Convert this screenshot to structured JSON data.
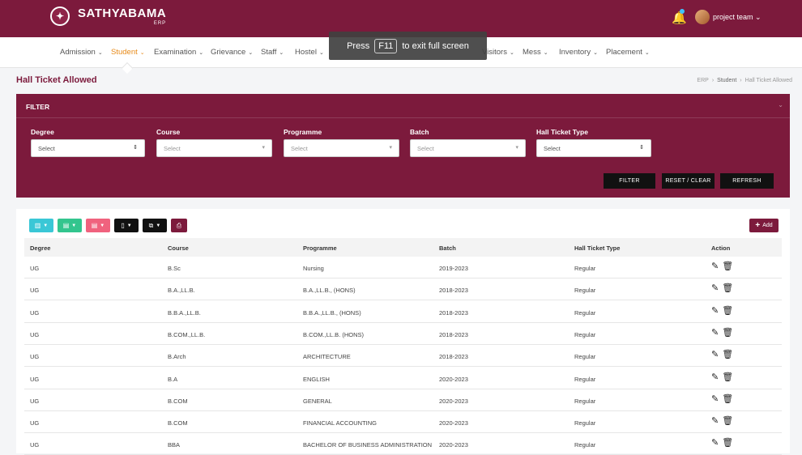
{
  "header": {
    "brand_name": "SATHYABAMA",
    "brand_sub": "ERP",
    "user_name": "project team",
    "user_caret": "⌄"
  },
  "nav": {
    "items": [
      {
        "label": "Admission"
      },
      {
        "label": "Student",
        "active": true
      },
      {
        "label": "Examination"
      },
      {
        "label": "Grievance"
      },
      {
        "label": "Staff"
      },
      {
        "label": "Hostel"
      },
      {
        "label": "Visitors"
      },
      {
        "label": "Mess"
      },
      {
        "label": "Inventory"
      },
      {
        "label": "Placement"
      }
    ],
    "accent_color": "#e78a19"
  },
  "toast": {
    "pre": "Press",
    "key": "F11",
    "post": "to exit full screen"
  },
  "page": {
    "title": "Hall Ticket Allowed",
    "breadcrumb": [
      "ERP",
      "Student",
      "Hall Ticket Allowed"
    ]
  },
  "filter": {
    "title": "FILTER",
    "fields": [
      {
        "label": "Degree",
        "value": "Select"
      },
      {
        "label": "Course",
        "value": "Select"
      },
      {
        "label": "Programme",
        "value": "Select"
      },
      {
        "label": "Batch",
        "value": "Select"
      },
      {
        "label": "Hall Ticket Type",
        "value": "Select"
      }
    ],
    "buttons": {
      "filter": "FILTER",
      "reset": "RESET / CLEAR",
      "refresh": "REFRESH"
    }
  },
  "table": {
    "add_label": "Add",
    "columns": [
      "Degree",
      "Course",
      "Programme",
      "Batch",
      "Hall Ticket Type",
      "Action"
    ],
    "rows": [
      {
        "degree": "UG",
        "course": "B.Sc",
        "programme": "Nursing",
        "batch": "2019-2023",
        "type": "Regular"
      },
      {
        "degree": "UG",
        "course": "B.A.,LL.B.",
        "programme": "B.A.,LL.B., (HONS)",
        "batch": "2018-2023",
        "type": "Regular"
      },
      {
        "degree": "UG",
        "course": "B.B.A.,LL.B.",
        "programme": "B.B.A.,LL.B., (HONS)",
        "batch": "2018-2023",
        "type": "Regular"
      },
      {
        "degree": "UG",
        "course": "B.COM.,LL.B.",
        "programme": "B.COM.,LL.B. (HONS)",
        "batch": "2018-2023",
        "type": "Regular"
      },
      {
        "degree": "UG",
        "course": "B.Arch",
        "programme": "ARCHITECTURE",
        "batch": "2018-2023",
        "type": "Regular"
      },
      {
        "degree": "UG",
        "course": "B.A",
        "programme": "ENGLISH",
        "batch": "2020-2023",
        "type": "Regular"
      },
      {
        "degree": "UG",
        "course": "B.COM",
        "programme": "GENERAL",
        "batch": "2020-2023",
        "type": "Regular"
      },
      {
        "degree": "UG",
        "course": "B.COM",
        "programme": "FINANCIAL ACCOUNTING",
        "batch": "2020-2023",
        "type": "Regular"
      },
      {
        "degree": "UG",
        "course": "BBA",
        "programme": "BACHELOR OF BUSINESS ADMINISTRATION",
        "batch": "2020-2023",
        "type": "Regular"
      }
    ]
  },
  "colors": {
    "brand": "#7c1a3c",
    "toolbar_teal": "#3ac7d6",
    "toolbar_green": "#33c58e",
    "toolbar_red": "#f0627e"
  }
}
